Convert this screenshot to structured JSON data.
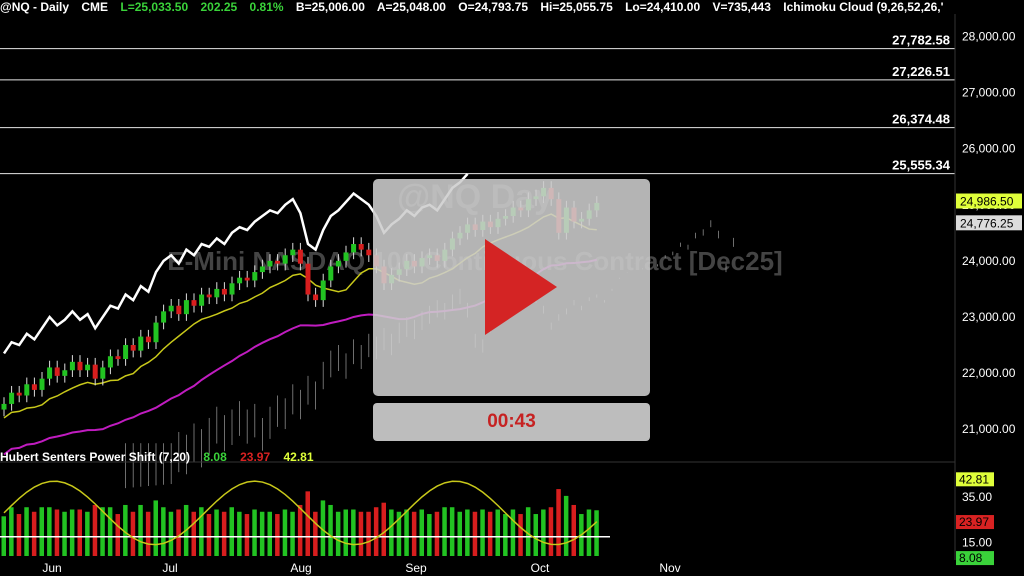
{
  "header": {
    "symbol": "@NQ - Daily",
    "exchange": "CME",
    "last": "L=25,033.50",
    "change": "202.25",
    "change_pct": "0.81%",
    "bid": "B=25,006.00",
    "ask": "A=25,048.00",
    "open": "O=24,793.75",
    "high": "Hi=25,055.75",
    "low": "Lo=24,410.00",
    "volume": "V=735,443",
    "indicator": "Ichimoku Cloud (9,26,52,26,'"
  },
  "watermark": {
    "line1": "@NQ Day",
    "line2": "E-Mini NASDAQ 100 Continuous Contract [Dec25]"
  },
  "video": {
    "timer": "00:43",
    "play_icon": "play-icon"
  },
  "oscillator": {
    "name": "Hubert Senters Power Shift (7,20)",
    "v1": "8.08",
    "v2": "23.97",
    "v3": "42.81"
  },
  "colors": {
    "up": "#22c322",
    "down": "#d81e1e",
    "tenkan": "#c8c81a",
    "kijun": "#c01cc0",
    "cloud": "#8a8a8a",
    "cloud_bear": "#c07028",
    "white_line": "#ffffff",
    "badge_last": "#e0ff3a",
    "badge_ask": "#dcdcdc",
    "badge_green": "#3ad23a",
    "badge_red": "#d82222"
  },
  "chart_data": {
    "type": "candlestick",
    "x_ticks": [
      "Jun",
      "Jul",
      "Aug",
      "Sep",
      "Oct",
      "Nov"
    ],
    "y_ticks": [
      "28,000.00",
      "27,000.00",
      "26,000.00",
      "25,000.00",
      "24,000.00",
      "23,000.00",
      "22,000.00",
      "21,000.00"
    ],
    "y_tick_values": [
      28000,
      27000,
      26000,
      25000,
      24000,
      23000,
      22000,
      21000
    ],
    "ylim": [
      20700,
      28400
    ],
    "levels": [
      {
        "label": "27,782.58",
        "value": 27782.58
      },
      {
        "label": "27,226.51",
        "value": 27226.51
      },
      {
        "label": "26,374.48",
        "value": 26374.48
      },
      {
        "label": "25,555.34",
        "value": 25555.34
      }
    ],
    "price_badges": [
      {
        "label": "24,986.50",
        "value": 24986.5,
        "kind": "last"
      },
      {
        "label": "24,776.25",
        "value": 24776.25,
        "kind": "ask"
      }
    ],
    "close": [
      21450,
      21650,
      21600,
      21800,
      21700,
      21900,
      22100,
      21950,
      22050,
      22200,
      22050,
      22150,
      21900,
      22100,
      22300,
      22250,
      22500,
      22400,
      22650,
      22550,
      22900,
      23100,
      23200,
      23050,
      23300,
      23200,
      23400,
      23350,
      23500,
      23400,
      23600,
      23700,
      23650,
      23800,
      23900,
      24000,
      23950,
      24100,
      24200,
      23950,
      23400,
      23300,
      23650,
      23900,
      24000,
      24150,
      24300,
      24200,
      24100,
      23900,
      23600,
      23750,
      23850,
      24000,
      23900,
      24050,
      24100,
      24000,
      24200,
      24400,
      24500,
      24650,
      24550,
      24700,
      24600,
      24750,
      24800,
      24950,
      24900,
      25100,
      25150,
      25300,
      25100,
      24500,
      24950,
      24700,
      24750,
      24900,
      25033
    ],
    "power_shift": {
      "oversold_line": 17.5,
      "y_ticks": [
        "35.00",
        "15.00"
      ],
      "y_tick_values": [
        35,
        15
      ],
      "ylim": [
        9,
        50
      ],
      "badges": [
        {
          "label": "42.81",
          "value": 42.81,
          "kind": "yellow"
        },
        {
          "label": "23.97",
          "value": 23.97,
          "kind": "red"
        },
        {
          "label": "8.08",
          "value": 8.08,
          "kind": "green"
        }
      ]
    }
  }
}
